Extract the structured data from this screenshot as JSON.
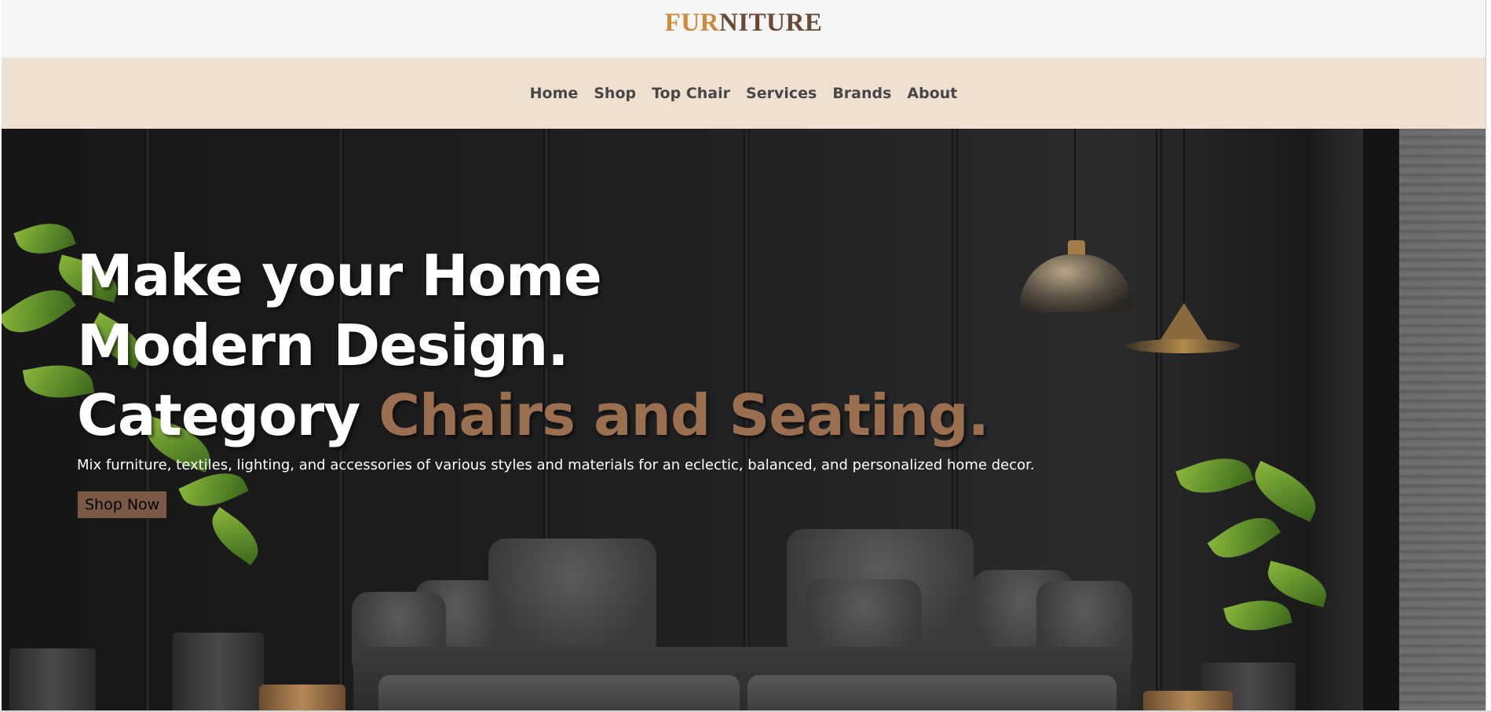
{
  "header": {
    "logo_part1": "FUR",
    "logo_part2": "NITURE",
    "logo_color_1": "#d08a3c",
    "logo_color_2": "#6a4a35",
    "background": "#f5f5f5"
  },
  "nav": {
    "background": "#efe1d1",
    "items": [
      {
        "label": "Home"
      },
      {
        "label": "Shop"
      },
      {
        "label": "Top Chair"
      },
      {
        "label": "Services"
      },
      {
        "label": "Brands"
      },
      {
        "label": "About"
      }
    ]
  },
  "hero": {
    "headline_line1": "Make your Home",
    "headline_line2": "Modern Design.",
    "headline_line3_prefix": "Category",
    "headline_line3_accent": "Chairs and Seating.",
    "accent_color": "#9a6f50",
    "description": "Mix furniture, textiles, lighting, and accessories of various styles and materials for an eclectic, balanced, and personalized home decor.",
    "cta_label": "Shop Now",
    "cta_color": "#7a5a45"
  }
}
